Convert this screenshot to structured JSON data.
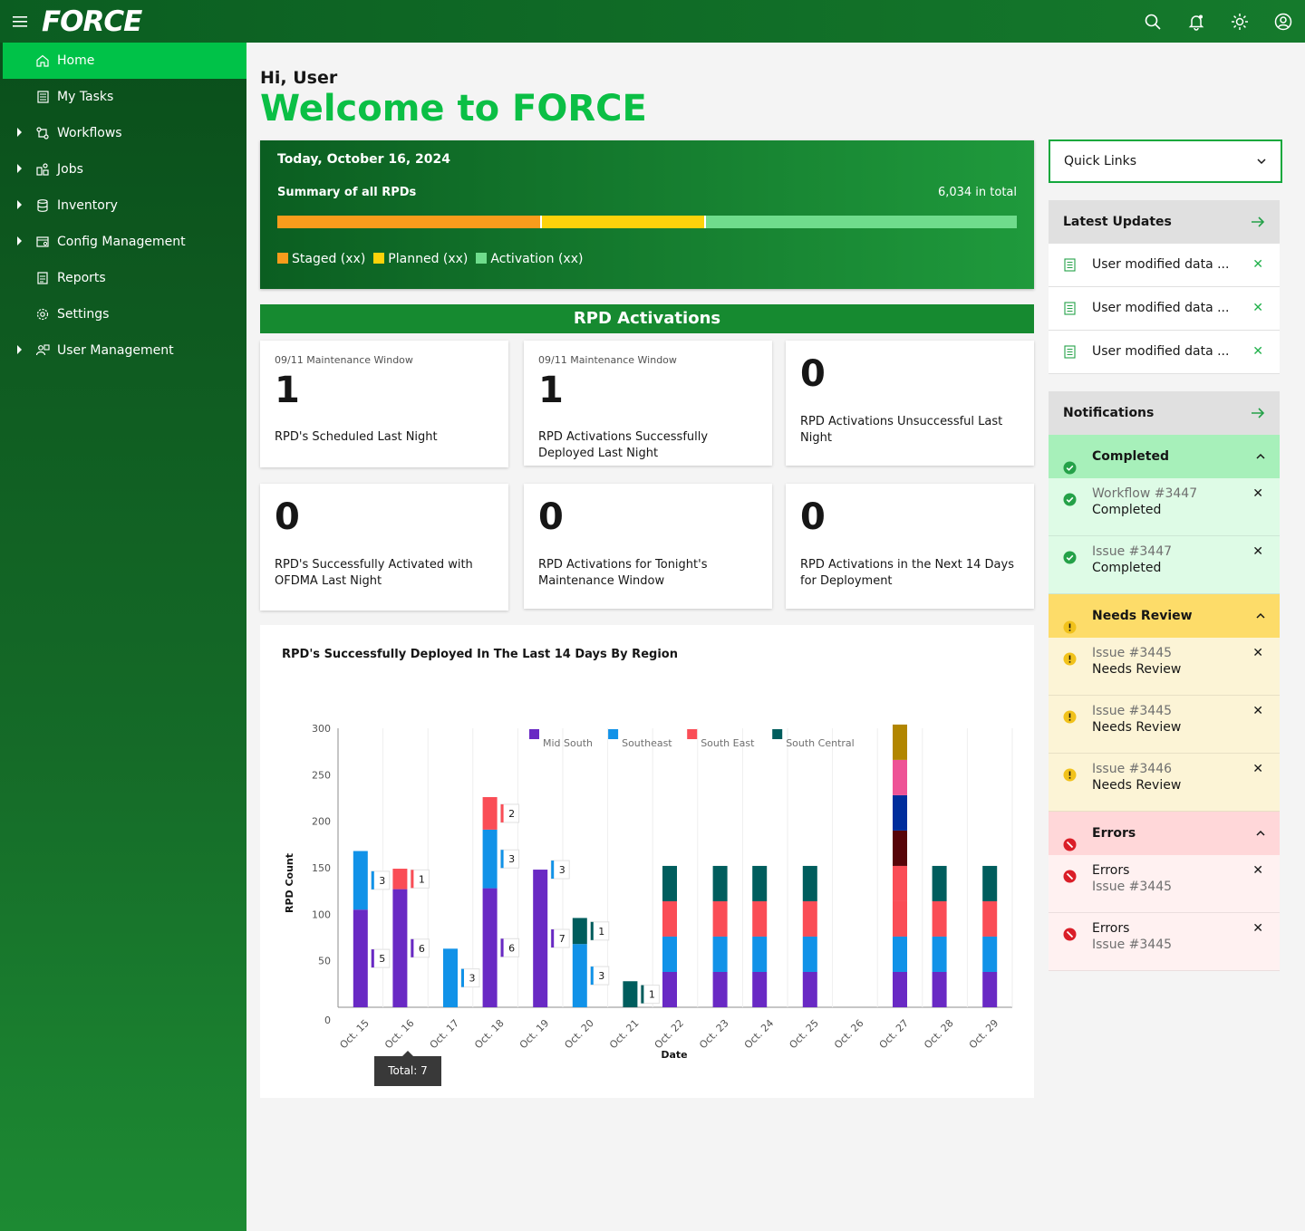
{
  "app": {
    "logo": "FORCE"
  },
  "topbar": {
    "icons": [
      "search-icon",
      "notification-icon",
      "theme-icon",
      "user-avatar-icon"
    ]
  },
  "sidebar": {
    "items": [
      {
        "label": "Home",
        "icon": "home-icon",
        "active": true,
        "expandable": false
      },
      {
        "label": "My Tasks",
        "icon": "tasks-icon",
        "expandable": false
      },
      {
        "label": "Workflows",
        "icon": "workflow-icon",
        "expandable": true
      },
      {
        "label": "Jobs",
        "icon": "jobs-icon",
        "expandable": true
      },
      {
        "label": "Inventory",
        "icon": "database-icon",
        "expandable": true
      },
      {
        "label": "Config Management",
        "icon": "config-icon",
        "expandable": true
      },
      {
        "label": "Reports",
        "icon": "report-icon",
        "expandable": false
      },
      {
        "label": "Settings",
        "icon": "gear-icon",
        "expandable": false
      },
      {
        "label": "User Management",
        "icon": "users-icon",
        "expandable": true
      }
    ]
  },
  "greeting": {
    "hi": "Hi, User",
    "welcome": "Welcome to FORCE"
  },
  "summary": {
    "date": "Today, October 16, 2024",
    "title": "Summary of all RPDs",
    "total": "6,034 in total",
    "bar": [
      {
        "label": "Staged (xx)",
        "fraction": 0.355,
        "color": "#f99c1c"
      },
      {
        "label": "Planned (xx)",
        "fraction": 0.222,
        "color": "#fdd20b"
      },
      {
        "label": "Activation (xx)",
        "fraction": 0.423,
        "color": "#6fdc8c"
      }
    ]
  },
  "activations": {
    "header": "RPD Activations",
    "cards": [
      {
        "caption": "09/11 Maintenance Window",
        "value": "1",
        "desc": "RPD's Scheduled Last Night"
      },
      {
        "caption": "09/11 Maintenance Window",
        "value": "1",
        "desc": "RPD Activations Successfully Deployed Last Night"
      },
      {
        "caption": "",
        "value": "0",
        "desc": "RPD Activations Unsuccessful Last Night"
      },
      {
        "caption": "",
        "value": "0",
        "desc": "RPD's Successfully Activated with OFDMA Last Night"
      },
      {
        "caption": "",
        "value": "0",
        "desc": "RPD Activations for Tonight's Maintenance Window"
      },
      {
        "caption": "",
        "value": "0",
        "desc": "RPD Activations in the Next 14 Days for Deployment"
      }
    ]
  },
  "chart_data": {
    "type": "bar",
    "stacked": true,
    "title": "RPD's Successfully Deployed In The Last 14 Days By Region",
    "xlabel": "Date",
    "ylabel": "RPD Count",
    "ylim": [
      0,
      300
    ],
    "yticks": [
      0,
      50,
      100,
      150,
      200,
      250,
      300
    ],
    "legend_position": "top",
    "categories": [
      "Oct. 15",
      "Oct. 16",
      "Oct. 17",
      "Oct. 18",
      "Oct. 19",
      "Oct. 20",
      "Oct. 21",
      "Oct. 22",
      "Oct. 23",
      "Oct. 24",
      "Oct. 25",
      "Oct. 26",
      "Oct. 27",
      "Oct. 28",
      "Oct. 29"
    ],
    "series": [
      {
        "name": "Mid South",
        "color": "#6929c4",
        "values": [
          [
            105,
            170
          ],
          [
            127,
            175
          ],
          null,
          [
            128,
            240
          ],
          [
            148,
            220
          ],
          null,
          null,
          [
            38,
            162
          ],
          [
            38,
            162
          ],
          [
            38,
            162
          ],
          [
            38,
            162
          ],
          null,
          [
            38,
            360
          ],
          [
            38,
            162
          ],
          [
            38,
            162
          ]
        ]
      },
      {
        "name": "Southeast",
        "color": "#1192e8",
        "values": [
          [
            63,
            170
          ],
          [
            0,
            175
          ],
          [
            63,
            175
          ],
          [
            63,
            240
          ],
          [
            0,
            220
          ],
          [
            68,
            180
          ],
          null,
          [
            38,
            162
          ],
          [
            38,
            162
          ],
          [
            38,
            162
          ],
          [
            38,
            162
          ],
          null,
          [
            38,
            360
          ],
          [
            38,
            162
          ],
          [
            38,
            162
          ]
        ]
      },
      {
        "name": "South East",
        "color": "#fa4d56",
        "values": [
          null,
          [
            22,
            175
          ],
          null,
          [
            35,
            240
          ],
          null,
          null,
          null,
          [
            38,
            162
          ],
          [
            38,
            162
          ],
          [
            38,
            162
          ],
          [
            38,
            162
          ],
          null,
          [
            38,
            360
          ],
          [
            38,
            162
          ],
          [
            38,
            162
          ]
        ]
      },
      {
        "name": "South Central",
        "color": "#005d5d",
        "values": [
          null,
          null,
          null,
          null,
          null,
          [
            28,
            180
          ],
          [
            28,
            175
          ],
          [
            38,
            162
          ],
          [
            38,
            162
          ],
          [
            38,
            162
          ],
          [
            38,
            162
          ],
          null,
          null,
          [
            38,
            162
          ],
          [
            38,
            162
          ]
        ]
      }
    ],
    "extra_segments": {
      "Oct. 27": [
        {
          "color": "#fa4d56",
          "value": 38
        },
        {
          "color": "#570408",
          "value": 38
        },
        {
          "color": "#002d9c",
          "value": 38
        },
        {
          "color": "#ee5396",
          "value": 38
        },
        {
          "color": "#b28600",
          "value": 38
        }
      ]
    },
    "data_labels": [
      {
        "category": "Oct. 15",
        "series": "Southeast",
        "text": "3"
      },
      {
        "category": "Oct. 15",
        "series": "Mid South",
        "text": "5"
      },
      {
        "category": "Oct. 16",
        "series": "South East",
        "text": "1"
      },
      {
        "category": "Oct. 16",
        "series": "Mid South",
        "text": "6"
      },
      {
        "category": "Oct. 17",
        "series": "Southeast",
        "text": "3"
      },
      {
        "category": "Oct. 18",
        "series": "South East",
        "text": "2"
      },
      {
        "category": "Oct. 18",
        "series": "Southeast",
        "text": "3"
      },
      {
        "category": "Oct. 18",
        "series": "Mid South",
        "text": "6"
      },
      {
        "category": "Oct. 19",
        "series": "Southeast",
        "text": "3"
      },
      {
        "category": "Oct. 19",
        "series": "Mid South",
        "text": "7"
      },
      {
        "category": "Oct. 20",
        "series": "Southeast",
        "text": "3"
      },
      {
        "category": "Oct. 20",
        "series": "South Central",
        "text": "1"
      },
      {
        "category": "Oct. 21",
        "series": "South Central",
        "text": "1"
      }
    ],
    "tooltip": {
      "category": "Oct. 16",
      "text": "Total: 7"
    },
    "grid": true
  },
  "quick_links": {
    "label": "Quick Links"
  },
  "latest_updates": {
    "title": "Latest Updates",
    "items": [
      "User modified data ...",
      "User modified data ...",
      "User modified data ..."
    ]
  },
  "notifications": {
    "title": "Notifications",
    "groups": [
      {
        "label": "Completed",
        "status": "success",
        "color": "#a7f0ba",
        "item_bg": "#defbe6",
        "icon_color": "#24a148",
        "items": [
          {
            "l1": "Workflow #3447",
            "l2": "Completed"
          },
          {
            "l1": "Issue #3447",
            "l2": "Completed"
          }
        ]
      },
      {
        "label": "Needs Review",
        "status": "warning",
        "color": "#fddc69",
        "item_bg": "#fcf4d6",
        "icon_color": "#f1c21b",
        "items": [
          {
            "l1": "Issue #3445",
            "l2": "Needs Review"
          },
          {
            "l1": "Issue #3445",
            "l2": "Needs Review"
          },
          {
            "l1": "Issue #3446",
            "l2": "Needs Review"
          }
        ]
      },
      {
        "label": "Errors",
        "status": "error",
        "color": "#ffd7d9",
        "item_bg": "#fff1f1",
        "icon_color": "#da1e28",
        "items": [
          {
            "l1": "Errors",
            "l2": "Issue #3445",
            "swap": true
          },
          {
            "l1": "Errors",
            "l2": "Issue #3445",
            "swap": true
          }
        ]
      }
    ]
  }
}
